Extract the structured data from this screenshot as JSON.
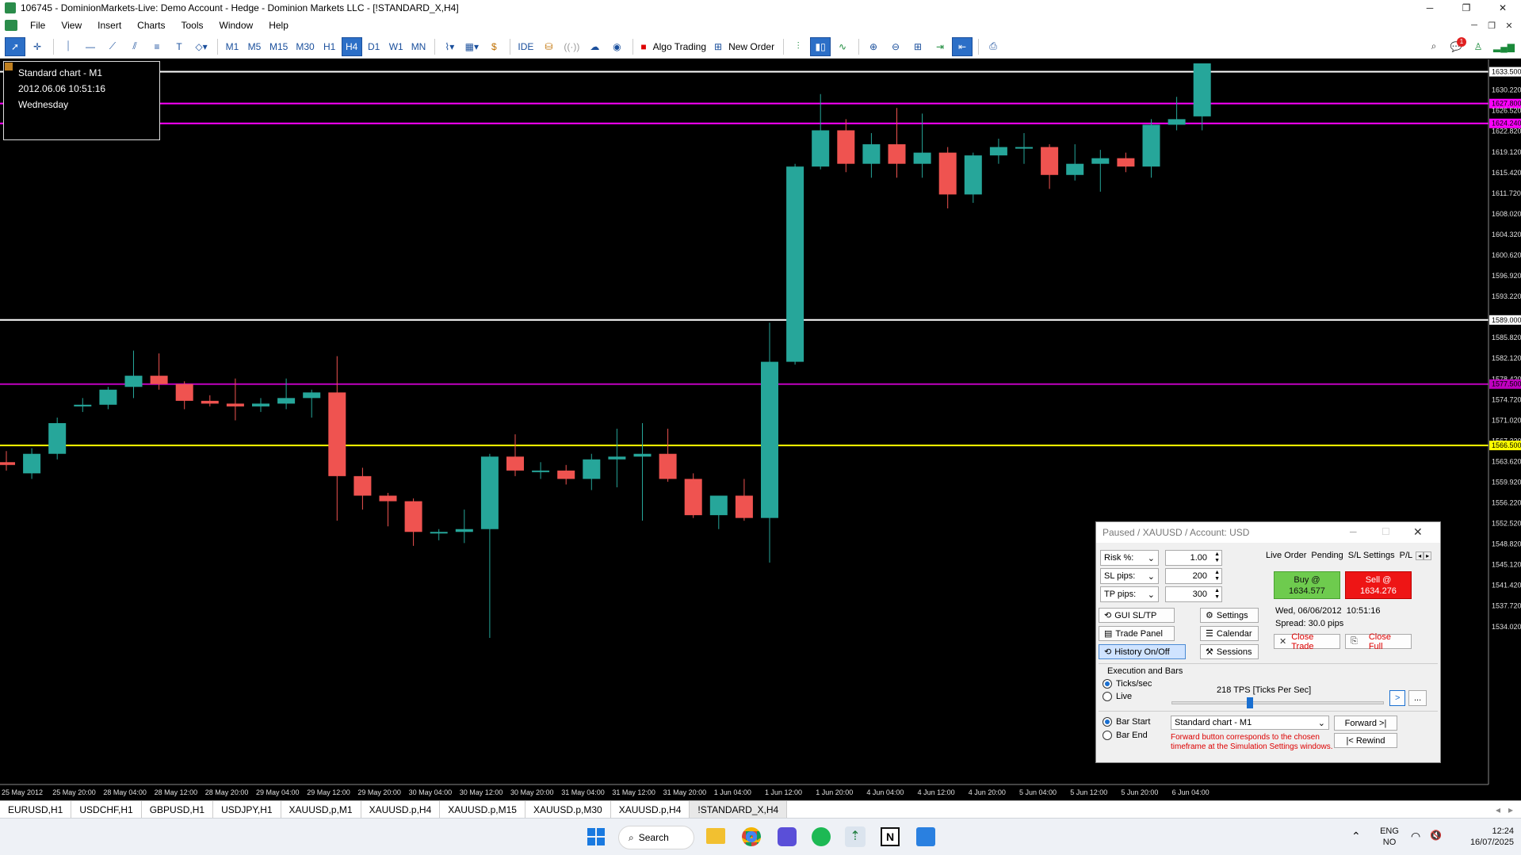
{
  "window": {
    "title": "106745 - DominionMarkets-Live: Demo Account - Hedge - Dominion Markets LLC - [!STANDARD_X,H4]",
    "minimize": "─",
    "maximize": "❐",
    "close": "✕"
  },
  "menu": [
    "File",
    "View",
    "Insert",
    "Charts",
    "Tools",
    "Window",
    "Help"
  ],
  "toolbar": {
    "timeframes": [
      "M1",
      "M5",
      "M15",
      "M30",
      "H1",
      "H4",
      "D1",
      "W1",
      "MN"
    ],
    "active_timeframe": "H4",
    "ide_label": "IDE",
    "algo_trading_label": "Algo Trading",
    "new_order_label": "New Order",
    "notification_count": "1"
  },
  "chart": {
    "info_lines": [
      "Standard chart - M1",
      "2012.06.06 10:51:16",
      "Wednesday"
    ],
    "price_labels": [
      "1633.500",
      "1630.220",
      "1627.800",
      "1626.520",
      "1624.240",
      "1622.820",
      "1619.120",
      "1615.420",
      "1611.720",
      "1608.020",
      "1604.320",
      "1600.620",
      "1596.920",
      "1593.220",
      "1589.000",
      "1585.820",
      "1582.120",
      "1578.420",
      "1577.500",
      "1574.720",
      "1571.020",
      "1567.320",
      "1566.500",
      "1563.620",
      "1559.920",
      "1556.220",
      "1552.520",
      "1548.820",
      "1545.120",
      "1541.420",
      "1537.720",
      "1534.020"
    ],
    "time_labels": [
      "25 May 2012",
      "25 May 20:00",
      "28 May 04:00",
      "28 May 12:00",
      "28 May 20:00",
      "29 May 04:00",
      "29 May 12:00",
      "29 May 20:00",
      "30 May 04:00",
      "30 May 12:00",
      "30 May 20:00",
      "31 May 04:00",
      "31 May 12:00",
      "31 May 20:00",
      "1 Jun 04:00",
      "1 Jun 12:00",
      "1 Jun 20:00",
      "4 Jun 04:00",
      "4 Jun 12:00",
      "4 Jun 20:00",
      "5 Jun 04:00",
      "5 Jun 12:00",
      "5 Jun 20:00",
      "6 Jun 04:00"
    ],
    "colors": {
      "bull": "#26a69a",
      "bear": "#ef5350",
      "magenta": "#ff00ff",
      "purple": "#c000c0",
      "yellow": "#ffff00",
      "white": "#ffffff"
    }
  },
  "chart_data": {
    "type": "candlestick",
    "symbol": "!STANDARD_X",
    "timeframe": "H4",
    "ylim": [
      1532,
      1635
    ],
    "candles": [
      {
        "o": 1563.5,
        "h": 1565.5,
        "l": 1562.0,
        "c": 1563.0
      },
      {
        "o": 1561.5,
        "h": 1566.0,
        "l": 1560.5,
        "c": 1565.0
      },
      {
        "o": 1565.0,
        "h": 1571.5,
        "l": 1564.0,
        "c": 1570.5
      },
      {
        "o": 1573.5,
        "h": 1575.0,
        "l": 1572.5,
        "c": 1573.8
      },
      {
        "o": 1573.8,
        "h": 1577.0,
        "l": 1573.0,
        "c": 1576.5
      },
      {
        "o": 1577.0,
        "h": 1583.5,
        "l": 1575.0,
        "c": 1579.0
      },
      {
        "o": 1579.0,
        "h": 1583.0,
        "l": 1576.5,
        "c": 1577.5
      },
      {
        "o": 1577.5,
        "h": 1578.0,
        "l": 1573.0,
        "c": 1574.5
      },
      {
        "o": 1574.5,
        "h": 1575.5,
        "l": 1573.5,
        "c": 1574.0
      },
      {
        "o": 1574.0,
        "h": 1578.5,
        "l": 1571.0,
        "c": 1573.5
      },
      {
        "o": 1573.5,
        "h": 1575.0,
        "l": 1572.5,
        "c": 1574.0
      },
      {
        "o": 1574.0,
        "h": 1578.5,
        "l": 1573.0,
        "c": 1575.0
      },
      {
        "o": 1575.0,
        "h": 1576.5,
        "l": 1571.5,
        "c": 1576.0
      },
      {
        "o": 1576.0,
        "h": 1582.5,
        "l": 1553.0,
        "c": 1561.0
      },
      {
        "o": 1561.0,
        "h": 1562.5,
        "l": 1555.0,
        "c": 1557.5
      },
      {
        "o": 1557.5,
        "h": 1558.0,
        "l": 1552.0,
        "c": 1556.5
      },
      {
        "o": 1556.5,
        "h": 1557.0,
        "l": 1548.5,
        "c": 1551.0
      },
      {
        "o": 1551.0,
        "h": 1551.5,
        "l": 1549.5,
        "c": 1551.0
      },
      {
        "o": 1551.0,
        "h": 1555.0,
        "l": 1549.0,
        "c": 1551.5
      },
      {
        "o": 1551.5,
        "h": 1565.0,
        "l": 1532.0,
        "c": 1564.5
      },
      {
        "o": 1564.5,
        "h": 1568.5,
        "l": 1561.0,
        "c": 1562.0
      },
      {
        "o": 1562.0,
        "h": 1563.5,
        "l": 1560.5,
        "c": 1562.0
      },
      {
        "o": 1562.0,
        "h": 1563.0,
        "l": 1559.5,
        "c": 1560.5
      },
      {
        "o": 1560.5,
        "h": 1565.0,
        "l": 1558.5,
        "c": 1564.0
      },
      {
        "o": 1564.0,
        "h": 1569.5,
        "l": 1559.0,
        "c": 1564.5
      },
      {
        "o": 1564.5,
        "h": 1570.5,
        "l": 1553.0,
        "c": 1565.0
      },
      {
        "o": 1565.0,
        "h": 1569.5,
        "l": 1560.0,
        "c": 1560.5
      },
      {
        "o": 1560.5,
        "h": 1561.5,
        "l": 1553.5,
        "c": 1554.0
      },
      {
        "o": 1554.0,
        "h": 1557.5,
        "l": 1551.5,
        "c": 1557.5
      },
      {
        "o": 1557.5,
        "h": 1560.5,
        "l": 1553.0,
        "c": 1553.5
      },
      {
        "o": 1553.5,
        "h": 1588.5,
        "l": 1545.5,
        "c": 1581.5
      },
      {
        "o": 1581.5,
        "h": 1617.0,
        "l": 1581.0,
        "c": 1616.5
      },
      {
        "o": 1616.5,
        "h": 1629.5,
        "l": 1616.0,
        "c": 1623.0
      },
      {
        "o": 1623.0,
        "h": 1625.0,
        "l": 1615.5,
        "c": 1617.0
      },
      {
        "o": 1617.0,
        "h": 1622.5,
        "l": 1614.5,
        "c": 1620.5
      },
      {
        "o": 1620.5,
        "h": 1627.0,
        "l": 1614.5,
        "c": 1617.0
      },
      {
        "o": 1617.0,
        "h": 1626.0,
        "l": 1614.5,
        "c": 1619.0
      },
      {
        "o": 1619.0,
        "h": 1620.0,
        "l": 1609.0,
        "c": 1611.5
      },
      {
        "o": 1611.5,
        "h": 1619.0,
        "l": 1610.0,
        "c": 1618.5
      },
      {
        "o": 1618.5,
        "h": 1621.5,
        "l": 1617.0,
        "c": 1620.0
      },
      {
        "o": 1620.0,
        "h": 1622.5,
        "l": 1617.0,
        "c": 1620.0
      },
      {
        "o": 1620.0,
        "h": 1620.5,
        "l": 1612.5,
        "c": 1615.0
      },
      {
        "o": 1615.0,
        "h": 1620.5,
        "l": 1614.0,
        "c": 1617.0
      },
      {
        "o": 1617.0,
        "h": 1619.5,
        "l": 1612.0,
        "c": 1618.0
      },
      {
        "o": 1618.0,
        "h": 1619.0,
        "l": 1615.5,
        "c": 1616.5
      },
      {
        "o": 1616.5,
        "h": 1625.0,
        "l": 1614.5,
        "c": 1624.0
      },
      {
        "o": 1624.0,
        "h": 1629.0,
        "l": 1623.0,
        "c": 1625.0
      },
      {
        "o": 1625.5,
        "h": 1635.0,
        "l": 1623.0,
        "c": 1635.0
      }
    ],
    "hlines": [
      {
        "price": 1633.5,
        "color": "#ffffff"
      },
      {
        "price": 1627.8,
        "color": "#ff00ff"
      },
      {
        "price": 1624.24,
        "color": "#ff00ff"
      },
      {
        "price": 1589.0,
        "color": "#ffffff"
      },
      {
        "price": 1577.5,
        "color": "#c000c0"
      },
      {
        "price": 1566.5,
        "color": "#ffff00"
      }
    ]
  },
  "sim_panel": {
    "title": "Paused / XAUUSD / Account: USD",
    "risk_label": "Risk %:",
    "risk_value": "1.00",
    "sl_label": "SL pips:",
    "sl_value": "200",
    "tp_label": "TP pips:",
    "tp_value": "300",
    "gui_sltp": "GUI SL/TP",
    "settings": "Settings",
    "trade_panel": "Trade Panel",
    "calendar": "Calendar",
    "history": "History On/Off",
    "sessions": "Sessions",
    "tabs": [
      "Live Order",
      "Pending",
      "S/L Settings",
      "P/L"
    ],
    "buy_label": "Buy @",
    "buy_price": "1634.577",
    "sell_label": "Sell @",
    "sell_price": "1634.276",
    "datetime": "Wed, 06/06/2012  10:51:16",
    "spread": "Spread: 30.0 pips",
    "close_trade": "Close Trade",
    "close_full": "Close Full",
    "exec_heading": "Execution and Bars",
    "ticks_label": "Ticks/sec",
    "live_label": "Live",
    "tps": "218 TPS [Ticks Per Sec]",
    "tps_fraction": 0.35,
    "play_btn": ">",
    "more_btn": "...",
    "bar_start": "Bar Start",
    "bar_end": "Bar End",
    "chart_select": "Standard chart - M1",
    "forward_btn": "Forward >|",
    "rewind_btn": "|< Rewind",
    "note": "Forward button corresponds to the chosen timeframe at the Simulation Settings windows."
  },
  "tabs": [
    "EURUSD,H1",
    "USDCHF,H1",
    "GBPUSD,H1",
    "USDJPY,H1",
    "XAUUSD,p,M1",
    "XAUUSD.p,H4",
    "XAUUSD.p,M15",
    "XAUUSD.p,M30",
    "XAUUSD.p,H4",
    "!STANDARD_X,H4"
  ],
  "active_tab": "!STANDARD_X,H4",
  "taskbar": {
    "search_label": "Search",
    "lang_line1": "ENG",
    "lang_line2": "NO",
    "time": "12:24",
    "date": "16/07/2025"
  }
}
